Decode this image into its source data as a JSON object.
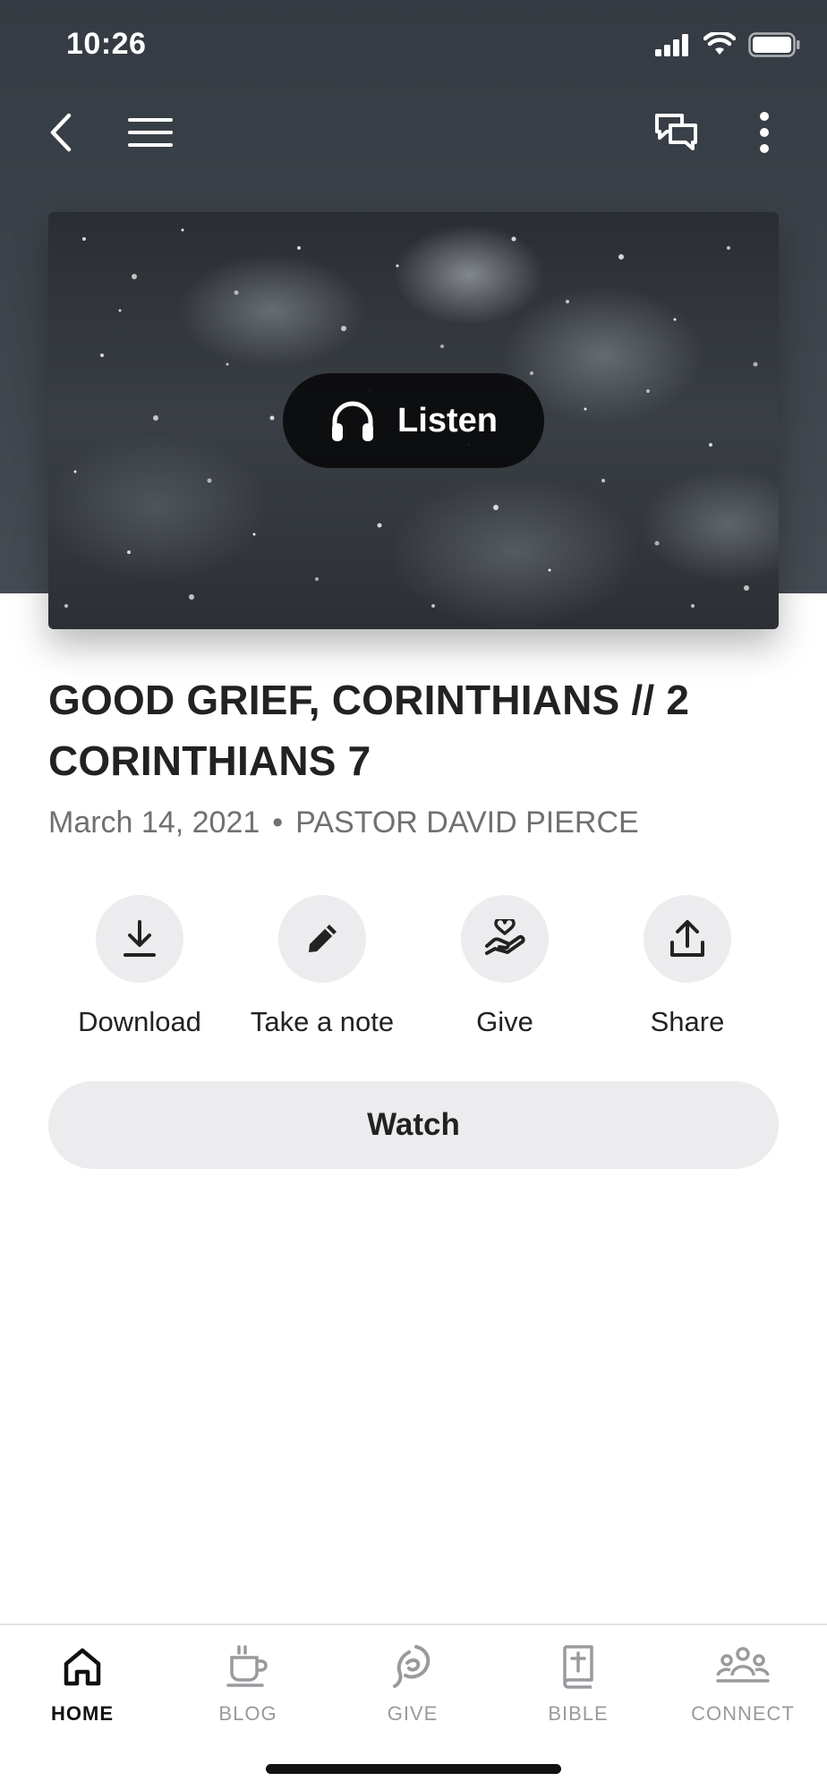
{
  "status_bar": {
    "time": "10:26"
  },
  "top_nav": {
    "back_icon": "chevron-left-icon",
    "menu_icon": "hamburger-icon",
    "chat_icon": "chat-bubbles-icon",
    "more_icon": "more-vertical-icon"
  },
  "hero": {
    "listen_label": "Listen",
    "listen_icon": "headphones-icon"
  },
  "sermon": {
    "title": "GOOD GRIEF, CORINTHIANS // 2 CORINTHIANS 7",
    "date": "March 14, 2021",
    "separator": "•",
    "speaker": "PASTOR DAVID PIERCE"
  },
  "actions": {
    "download": "Download",
    "note": "Take a note",
    "give": "Give",
    "share": "Share"
  },
  "watch_label": "Watch",
  "tabs": {
    "home": "HOME",
    "blog": "BLOG",
    "give": "GIVE",
    "bible": "BIBLE",
    "connect": "CONNECT"
  },
  "colors": {
    "header_bg": "#3e444b",
    "button_bg": "#ececee",
    "text_primary": "#222222",
    "text_secondary": "#707070",
    "tab_inactive": "#9a9a9e"
  }
}
